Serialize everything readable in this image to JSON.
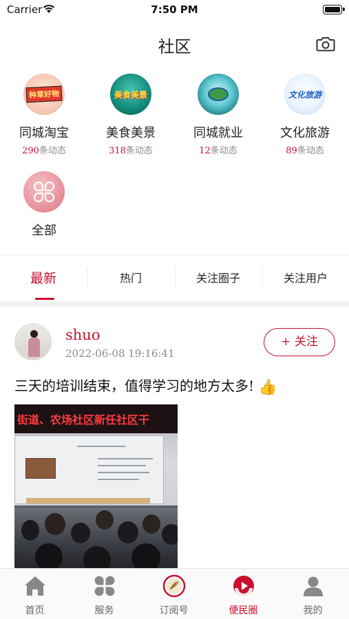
{
  "status_bar": {
    "carrier": "Carrier",
    "time": "7:50 PM"
  },
  "header": {
    "title": "社区",
    "camera_icon": "camera-icon"
  },
  "circles": [
    {
      "name": "同城淘宝",
      "count": "290",
      "suffix": "条动态",
      "badge": "种草好物"
    },
    {
      "name": "美食美景",
      "count": "318",
      "suffix": "条动态",
      "badge": "美食美景"
    },
    {
      "name": "同城就业",
      "count": "12",
      "suffix": "条动态"
    },
    {
      "name": "文化旅游",
      "count": "89",
      "suffix": "条动态",
      "badge": "文化旅游"
    },
    {
      "name": "全部"
    }
  ],
  "tabs": [
    {
      "label": "最新",
      "active": true
    },
    {
      "label": "热门"
    },
    {
      "label": "关注圈子"
    },
    {
      "label": "关注用户"
    }
  ],
  "post": {
    "username": "shuo",
    "time": "2022-06-08 19:16:41",
    "follow_label": "+ 关注",
    "text": "三天的培训结束，值得学习的地方太多!",
    "emoji": "👍",
    "photo_banner": "街道、农场社区新任社区干"
  },
  "tabbar": [
    {
      "label": "首页",
      "icon": "home-icon"
    },
    {
      "label": "服务",
      "icon": "grid-icon"
    },
    {
      "label": "订阅号",
      "icon": "subscription-icon"
    },
    {
      "label": "便民圈",
      "icon": "community-icon",
      "active": true
    },
    {
      "label": "我的",
      "icon": "profile-icon"
    }
  ],
  "colors": {
    "accent": "#c8102e",
    "muted": "#8a8a8a"
  }
}
